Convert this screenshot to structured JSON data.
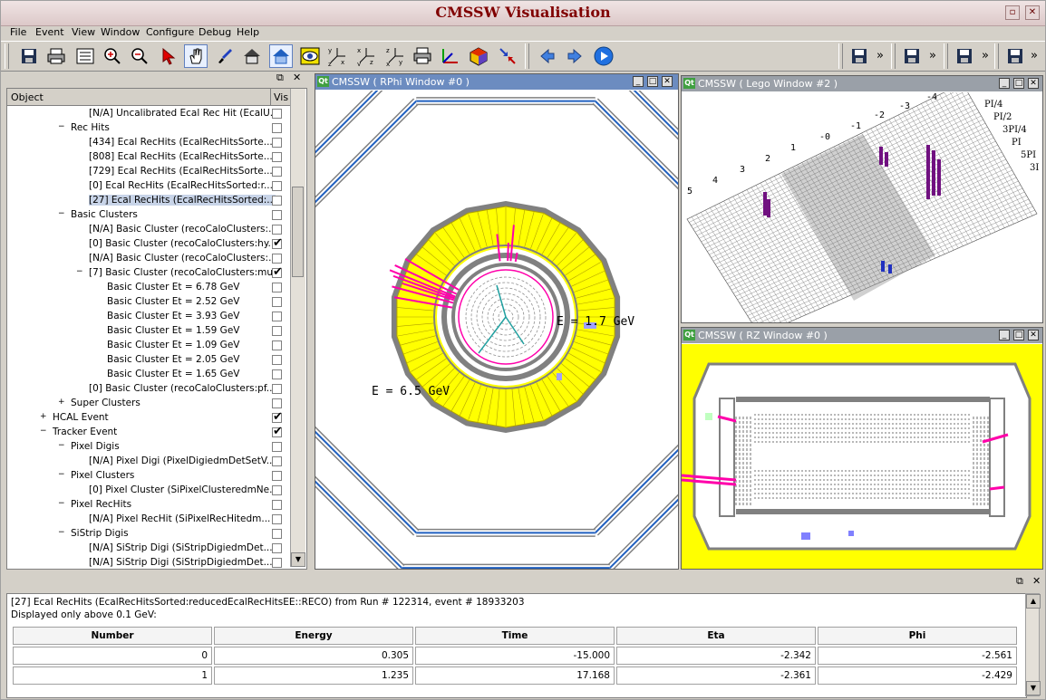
{
  "app": {
    "title": "CMSSW Visualisation",
    "title_buttons": [
      "▫",
      "▢",
      "✕"
    ]
  },
  "menu": {
    "items": [
      "File",
      "Event",
      "View",
      "Window",
      "Configure",
      "Debug",
      "Help"
    ],
    "mnemonics": [
      "F",
      "E",
      "V",
      "W",
      "",
      "D",
      "H"
    ]
  },
  "toolbar": {
    "more_symbol": "»",
    "icons": [
      "save-icon",
      "print-icon",
      "select-all-icon",
      "zoom-in-icon",
      "zoom-out-icon",
      "pointer-icon",
      "hand-icon",
      "brush-icon",
      "home-icon",
      "home-active-icon",
      "eye-icon",
      "view-xyz-icon",
      "view-yxz-icon",
      "view-zyx-icon",
      "print-preview-icon",
      "axes-icon",
      "cube-icon",
      "arrows-icon",
      "back-icon",
      "forward-icon",
      "play-icon"
    ]
  },
  "tree": {
    "col_object": "Object",
    "col_vis": "Vis",
    "rows": [
      {
        "indent": 5,
        "expander": "",
        "label": "[N/A] Uncalibrated Ecal Rec Hit (EcalU...",
        "check": false,
        "selected": false
      },
      {
        "indent": 4,
        "expander": "−",
        "label": "Rec Hits",
        "check": false,
        "selected": false
      },
      {
        "indent": 5,
        "expander": "",
        "label": "[434] Ecal RecHits (EcalRecHitsSorte...",
        "check": false,
        "selected": false
      },
      {
        "indent": 5,
        "expander": "",
        "label": "[808] Ecal RecHits (EcalRecHitsSorte...",
        "check": false,
        "selected": false
      },
      {
        "indent": 5,
        "expander": "",
        "label": "[729] Ecal RecHits (EcalRecHitsSorte...",
        "check": false,
        "selected": false
      },
      {
        "indent": 5,
        "expander": "",
        "label": "[0] Ecal RecHits (EcalRecHitsSorted:r...",
        "check": false,
        "selected": false
      },
      {
        "indent": 5,
        "expander": "",
        "label": "[27] Ecal RecHits (EcalRecHitsSorted:...",
        "check": false,
        "selected": true
      },
      {
        "indent": 4,
        "expander": "−",
        "label": "Basic Clusters",
        "check": false,
        "selected": false
      },
      {
        "indent": 5,
        "expander": "",
        "label": "[N/A] Basic Cluster (recoCaloClusters:...",
        "check": false,
        "selected": false
      },
      {
        "indent": 5,
        "expander": "",
        "label": "[0] Basic Cluster (recoCaloClusters:hy...",
        "check": true,
        "selected": false
      },
      {
        "indent": 5,
        "expander": "",
        "label": "[N/A] Basic Cluster (recoCaloClusters:...",
        "check": false,
        "selected": false
      },
      {
        "indent": 5,
        "expander": "−",
        "label": "[7] Basic Cluster (recoCaloClusters:mu...",
        "check": true,
        "selected": false
      },
      {
        "indent": 6,
        "expander": "",
        "label": "Basic Cluster Et = 6.78 GeV",
        "check": false,
        "selected": false
      },
      {
        "indent": 6,
        "expander": "",
        "label": "Basic Cluster Et = 2.52 GeV",
        "check": false,
        "selected": false
      },
      {
        "indent": 6,
        "expander": "",
        "label": "Basic Cluster Et = 3.93 GeV",
        "check": false,
        "selected": false
      },
      {
        "indent": 6,
        "expander": "",
        "label": "Basic Cluster Et = 1.59 GeV",
        "check": false,
        "selected": false
      },
      {
        "indent": 6,
        "expander": "",
        "label": "Basic Cluster Et = 1.09 GeV",
        "check": false,
        "selected": false
      },
      {
        "indent": 6,
        "expander": "",
        "label": "Basic Cluster Et = 2.05 GeV",
        "check": false,
        "selected": false
      },
      {
        "indent": 6,
        "expander": "",
        "label": "Basic Cluster Et = 1.65 GeV",
        "check": false,
        "selected": false
      },
      {
        "indent": 5,
        "expander": "",
        "label": "[0] Basic Cluster (recoCaloClusters:pf...",
        "check": false,
        "selected": false
      },
      {
        "indent": 4,
        "expander": "+",
        "label": "Super Clusters",
        "check": false,
        "selected": false
      },
      {
        "indent": 3,
        "expander": "+",
        "label": "HCAL Event",
        "check": true,
        "selected": false
      },
      {
        "indent": 3,
        "expander": "−",
        "label": "Tracker Event",
        "check": true,
        "selected": false
      },
      {
        "indent": 4,
        "expander": "−",
        "label": "Pixel Digis",
        "check": false,
        "selected": false
      },
      {
        "indent": 5,
        "expander": "",
        "label": "[N/A] Pixel Digi (PixelDigiedmDetSetV...",
        "check": false,
        "selected": false
      },
      {
        "indent": 4,
        "expander": "−",
        "label": "Pixel Clusters",
        "check": false,
        "selected": false
      },
      {
        "indent": 5,
        "expander": "",
        "label": "[0] Pixel Cluster (SiPixelClusteredmNe...",
        "check": false,
        "selected": false
      },
      {
        "indent": 4,
        "expander": "−",
        "label": "Pixel RecHits",
        "check": false,
        "selected": false
      },
      {
        "indent": 5,
        "expander": "",
        "label": "[N/A] Pixel RecHit (SiPixelRecHitedm...",
        "check": false,
        "selected": false
      },
      {
        "indent": 4,
        "expander": "−",
        "label": "SiStrip Digis",
        "check": false,
        "selected": false
      },
      {
        "indent": 5,
        "expander": "",
        "label": "[N/A] SiStrip Digi (SiStripDigiedmDet...",
        "check": false,
        "selected": false
      },
      {
        "indent": 5,
        "expander": "",
        "label": "[N/A] SiStrip Digi (SiStripDigiedmDet...",
        "check": false,
        "selected": false
      }
    ]
  },
  "windows": {
    "rphi": {
      "title": "CMSSW ( RPhi Window #0 )",
      "label_a": "E = 1.7 GeV",
      "label_b": "E = 6.5 GeV",
      "active": true
    },
    "lego": {
      "title": "CMSSW ( Lego Window #2 )",
      "eta_labels": [
        "-4",
        "-3",
        "-2",
        "-1",
        "-0",
        "1",
        "2",
        "3",
        "4",
        "5"
      ],
      "phi_labels": [
        "PI/4",
        "PI/2",
        "3PI/4",
        "PI",
        "5PI",
        "3I"
      ]
    },
    "rz": {
      "title": "CMSSW ( RZ Window #0 )"
    },
    "qt_badge": "Qt",
    "buttons": [
      "_",
      "□",
      "✕"
    ]
  },
  "bottom": {
    "line1": "[27] Ecal RecHits (EcalRecHitsSorted:reducedEcalRecHitsEE::RECO) from Run # 122314, event # 18933203",
    "line2": "Displayed only above 0.1 GeV:",
    "headers": [
      "Number",
      "Energy",
      "Time",
      "Eta",
      "Phi"
    ],
    "rows": [
      [
        "0",
        "0.305",
        "-15.000",
        "-2.342",
        "-2.561"
      ],
      [
        "1",
        "1.235",
        "17.168",
        "-2.361",
        "-2.429"
      ]
    ]
  },
  "colors": {
    "yellow": "#ffff00",
    "magenta": "#ff00aa",
    "blue": "#2060c0",
    "grey": "#808080",
    "title": "#800000"
  }
}
